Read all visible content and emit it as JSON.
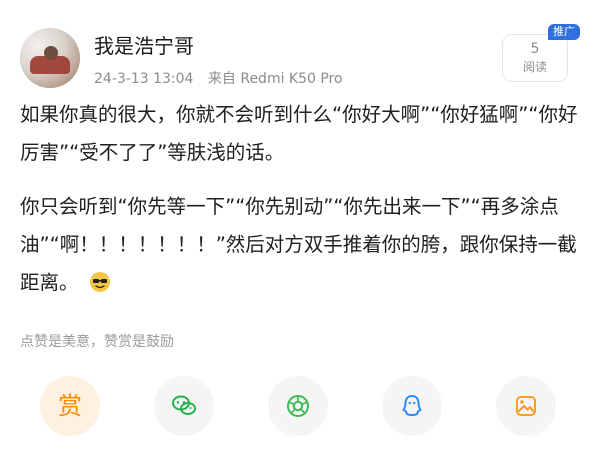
{
  "post": {
    "username": "我是浩宁哥",
    "timestamp": "24-3-13 13:04",
    "source": "来自 Redmi K50 Pro",
    "promo_badge": "推广",
    "read_count": "5",
    "read_label": "阅读",
    "paragraphs": [
      "如果你真的很大，你就不会听到什么“你好大啊”“你好猛啊”“你好厉害”“受不了了”等肤浅的话。",
      "你只会听到“你先等一下”“你先别动”“你先出来一下”“再多涂点油”“啊！！！！！！！”然后对方双手推着你的胯，跟你保持一截距离。"
    ]
  },
  "tip": "点赞是美意，赞赏是鼓励",
  "actions": {
    "reward_label": "赏"
  },
  "icons": {
    "emoji": "cool-sunglasses-icon",
    "wechat": "wechat-icon",
    "moments": "moments-icon",
    "qq": "qq-icon",
    "image": "image-icon"
  },
  "colors": {
    "reward": "#ff8a00",
    "wechat": "#22b14c",
    "moments": "#3bbd53",
    "qq": "#2b8cff",
    "image": "#ff9b1f",
    "badge": "#2f6fe0"
  }
}
